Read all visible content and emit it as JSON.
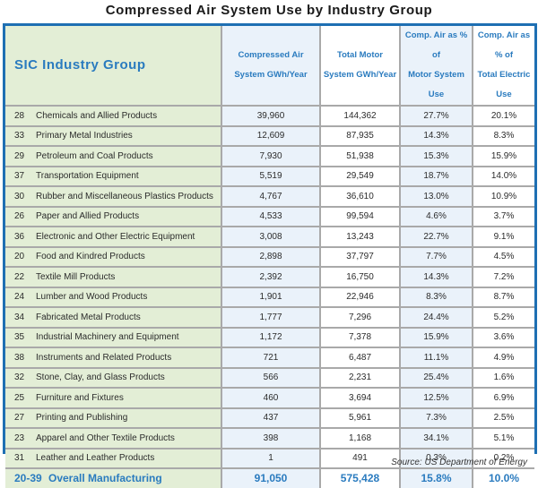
{
  "title": "Compressed Air System Use by Industry Group",
  "headers": {
    "group": "SIC Industry Group",
    "air_1": "Compressed Air",
    "air_2": "System GWh/Year",
    "motor_1": "Total Motor",
    "motor_2": "System GWh/Year",
    "pct_motor_1": "Comp. Air as % of",
    "pct_motor_2": "Motor System Use",
    "pct_elec_1": "Comp. Air as % of",
    "pct_elec_2": "Total Electric Use"
  },
  "rows": [
    {
      "code": "28",
      "name": "Chemicals and Allied Products",
      "air": "39,960",
      "motor": "144,362",
      "pct_motor": "27.7%",
      "pct_elec": "20.1%"
    },
    {
      "code": "33",
      "name": "Primary Metal Industries",
      "air": "12,609",
      "motor": "87,935",
      "pct_motor": "14.3%",
      "pct_elec": "8.3%"
    },
    {
      "code": "29",
      "name": "Petroleum and Coal Products",
      "air": "7,930",
      "motor": "51,938",
      "pct_motor": "15.3%",
      "pct_elec": "15.9%"
    },
    {
      "code": "37",
      "name": "Transportation Equipment",
      "air": "5,519",
      "motor": "29,549",
      "pct_motor": "18.7%",
      "pct_elec": "14.0%"
    },
    {
      "code": "30",
      "name": "Rubber and Miscellaneous Plastics Products",
      "air": "4,767",
      "motor": "36,610",
      "pct_motor": "13.0%",
      "pct_elec": "10.9%"
    },
    {
      "code": "26",
      "name": "Paper and Allied Products",
      "air": "4,533",
      "motor": "99,594",
      "pct_motor": "4.6%",
      "pct_elec": "3.7%"
    },
    {
      "code": "36",
      "name": "Electronic and Other Electric Equipment",
      "air": "3,008",
      "motor": "13,243",
      "pct_motor": "22.7%",
      "pct_elec": "9.1%"
    },
    {
      "code": "20",
      "name": "Food and Kindred Products",
      "air": "2,898",
      "motor": "37,797",
      "pct_motor": "7.7%",
      "pct_elec": "4.5%"
    },
    {
      "code": "22",
      "name": "Textile Mill Products",
      "air": "2,392",
      "motor": "16,750",
      "pct_motor": "14.3%",
      "pct_elec": "7.2%"
    },
    {
      "code": "24",
      "name": "Lumber and Wood Products",
      "air": "1,901",
      "motor": "22,946",
      "pct_motor": "8.3%",
      "pct_elec": "8.7%"
    },
    {
      "code": "34",
      "name": "Fabricated Metal Products",
      "air": "1,777",
      "motor": "7,296",
      "pct_motor": "24.4%",
      "pct_elec": "5.2%"
    },
    {
      "code": "35",
      "name": "Industrial Machinery and Equipment",
      "air": "1,172",
      "motor": "7,378",
      "pct_motor": "15.9%",
      "pct_elec": "3.6%"
    },
    {
      "code": "38",
      "name": "Instruments and Related Products",
      "air": "721",
      "motor": "6,487",
      "pct_motor": "11.1%",
      "pct_elec": "4.9%"
    },
    {
      "code": "32",
      "name": "Stone, Clay, and Glass Products",
      "air": "566",
      "motor": "2,231",
      "pct_motor": "25.4%",
      "pct_elec": "1.6%"
    },
    {
      "code": "25",
      "name": "Furniture and Fixtures",
      "air": "460",
      "motor": "3,694",
      "pct_motor": "12.5%",
      "pct_elec": "6.9%"
    },
    {
      "code": "27",
      "name": "Printing and Publishing",
      "air": "437",
      "motor": "5,961",
      "pct_motor": "7.3%",
      "pct_elec": "2.5%"
    },
    {
      "code": "23",
      "name": "Apparel and Other Textile Products",
      "air": "398",
      "motor": "1,168",
      "pct_motor": "34.1%",
      "pct_elec": "5.1%"
    },
    {
      "code": "31",
      "name": "Leather and Leather Products",
      "air": "1",
      "motor": "491",
      "pct_motor": "0.3%",
      "pct_elec": "0.2%"
    }
  ],
  "total": {
    "code": "20-39",
    "name": "Overall Manufacturing",
    "air": "91,050",
    "motor": "575,428",
    "pct_motor": "15.8%",
    "pct_elec": "10.0%"
  },
  "source": "Source:  US Department of Energy"
}
